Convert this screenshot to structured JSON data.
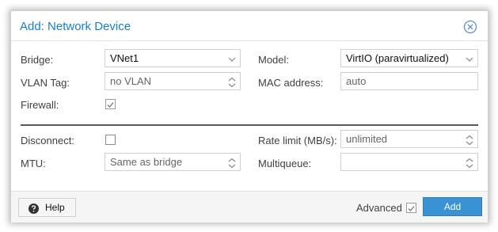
{
  "dialog": {
    "title": "Add: Network Device"
  },
  "fields": {
    "bridge": {
      "label": "Bridge:",
      "value": "VNet1"
    },
    "model": {
      "label": "Model:",
      "value": "VirtIO (paravirtualized)"
    },
    "vlan_tag": {
      "label": "VLAN Tag:",
      "placeholder": "no VLAN"
    },
    "mac_address": {
      "label": "MAC address:",
      "placeholder": "auto"
    },
    "firewall": {
      "label": "Firewall:",
      "checked": true
    },
    "disconnect": {
      "label": "Disconnect:",
      "checked": false
    },
    "rate_limit": {
      "label": "Rate limit (MB/s):",
      "placeholder": "unlimited"
    },
    "mtu": {
      "label": "MTU:",
      "placeholder": "Same as bridge"
    },
    "multiqueue": {
      "label": "Multiqueue:",
      "placeholder": ""
    }
  },
  "footer": {
    "help_label": "Help",
    "advanced_label": "Advanced",
    "advanced_checked": true,
    "add_label": "Add"
  },
  "icons": {
    "close": "close-circle-icon",
    "dropdown": "chevron-down-icon",
    "spinner": "spinner-arrows-icon",
    "help": "question-circle-icon",
    "check": "checkmark-icon"
  },
  "colors": {
    "title": "#157fcc",
    "primary_button": "#3892d4",
    "footer_bg": "#f5f5f5",
    "divider": "#5a5a5a"
  }
}
